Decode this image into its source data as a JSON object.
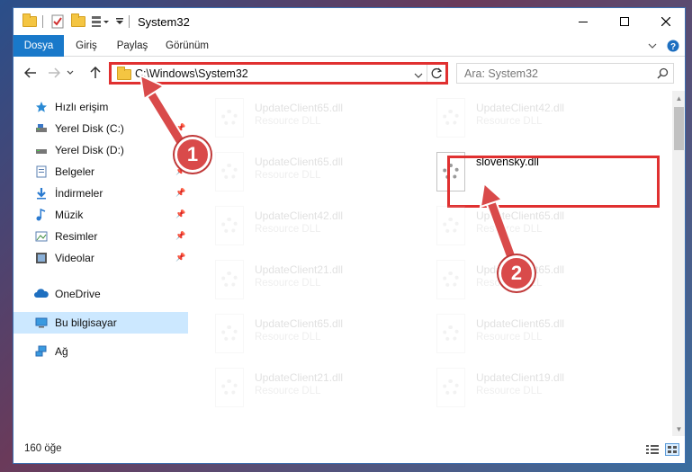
{
  "window": {
    "title": "System32"
  },
  "ribbon": {
    "tabs": [
      {
        "label": "Dosya"
      },
      {
        "label": "Giriş"
      },
      {
        "label": "Paylaş"
      },
      {
        "label": "Görünüm"
      }
    ],
    "expand_icon": "chevron-down-icon",
    "help_icon": "help-icon"
  },
  "address": {
    "path": "C:\\Windows\\System32",
    "search_placeholder": "Ara: System32"
  },
  "nav": {
    "items": [
      {
        "label": "Hızlı erişim",
        "icon": "star-icon"
      },
      {
        "label": "Yerel Disk (C:)",
        "icon": "drive-icon"
      },
      {
        "label": "Yerel Disk (D:)",
        "icon": "drive-icon"
      },
      {
        "label": "Belgeler",
        "icon": "documents-icon"
      },
      {
        "label": "İndirmeler",
        "icon": "download-icon"
      },
      {
        "label": "Müzik",
        "icon": "music-icon"
      },
      {
        "label": "Resimler",
        "icon": "pictures-icon"
      },
      {
        "label": "Videolar",
        "icon": "video-icon"
      },
      {
        "label": "OneDrive",
        "icon": "cloud-icon"
      },
      {
        "label": "Bu bilgisayar",
        "icon": "computer-icon"
      },
      {
        "label": "Ağ",
        "icon": "network-icon"
      }
    ],
    "selected": "Bu bilgisayar"
  },
  "files": {
    "left": [
      {
        "name": "UpdateClient65.dll",
        "type": "Resource DLL"
      },
      {
        "name": "UpdateClient65.dll",
        "type": "Resource DLL"
      },
      {
        "name": "UpdateClient42.dll",
        "type": "Resource DLL"
      },
      {
        "name": "UpdateClient21.dll",
        "type": "Resource DLL"
      },
      {
        "name": "UpdateClient65.dll",
        "type": "Resource DLL"
      },
      {
        "name": "UpdateClient21.dll",
        "type": "Resource DLL"
      }
    ],
    "right": [
      {
        "name": "UpdateClient42.dll",
        "type": "Resource DLL"
      },
      {
        "name": "slovensky.dll",
        "type": ""
      },
      {
        "name": "UpdateClient65.dll",
        "type": "Resource DLL"
      },
      {
        "name": "UpdateClient65.dll",
        "type": "Resource DLL"
      },
      {
        "name": "UpdateClient65.dll",
        "type": "Resource DLL"
      },
      {
        "name": "UpdateClient19.dll",
        "type": "Resource DLL"
      }
    ]
  },
  "status": {
    "count": "160 öğe"
  },
  "annotations": {
    "step1": "1",
    "step2": "2",
    "color": "#e03030"
  },
  "colors": {
    "accent": "#1979ca",
    "highlight": "#e03030",
    "selected": "#cce8ff"
  }
}
